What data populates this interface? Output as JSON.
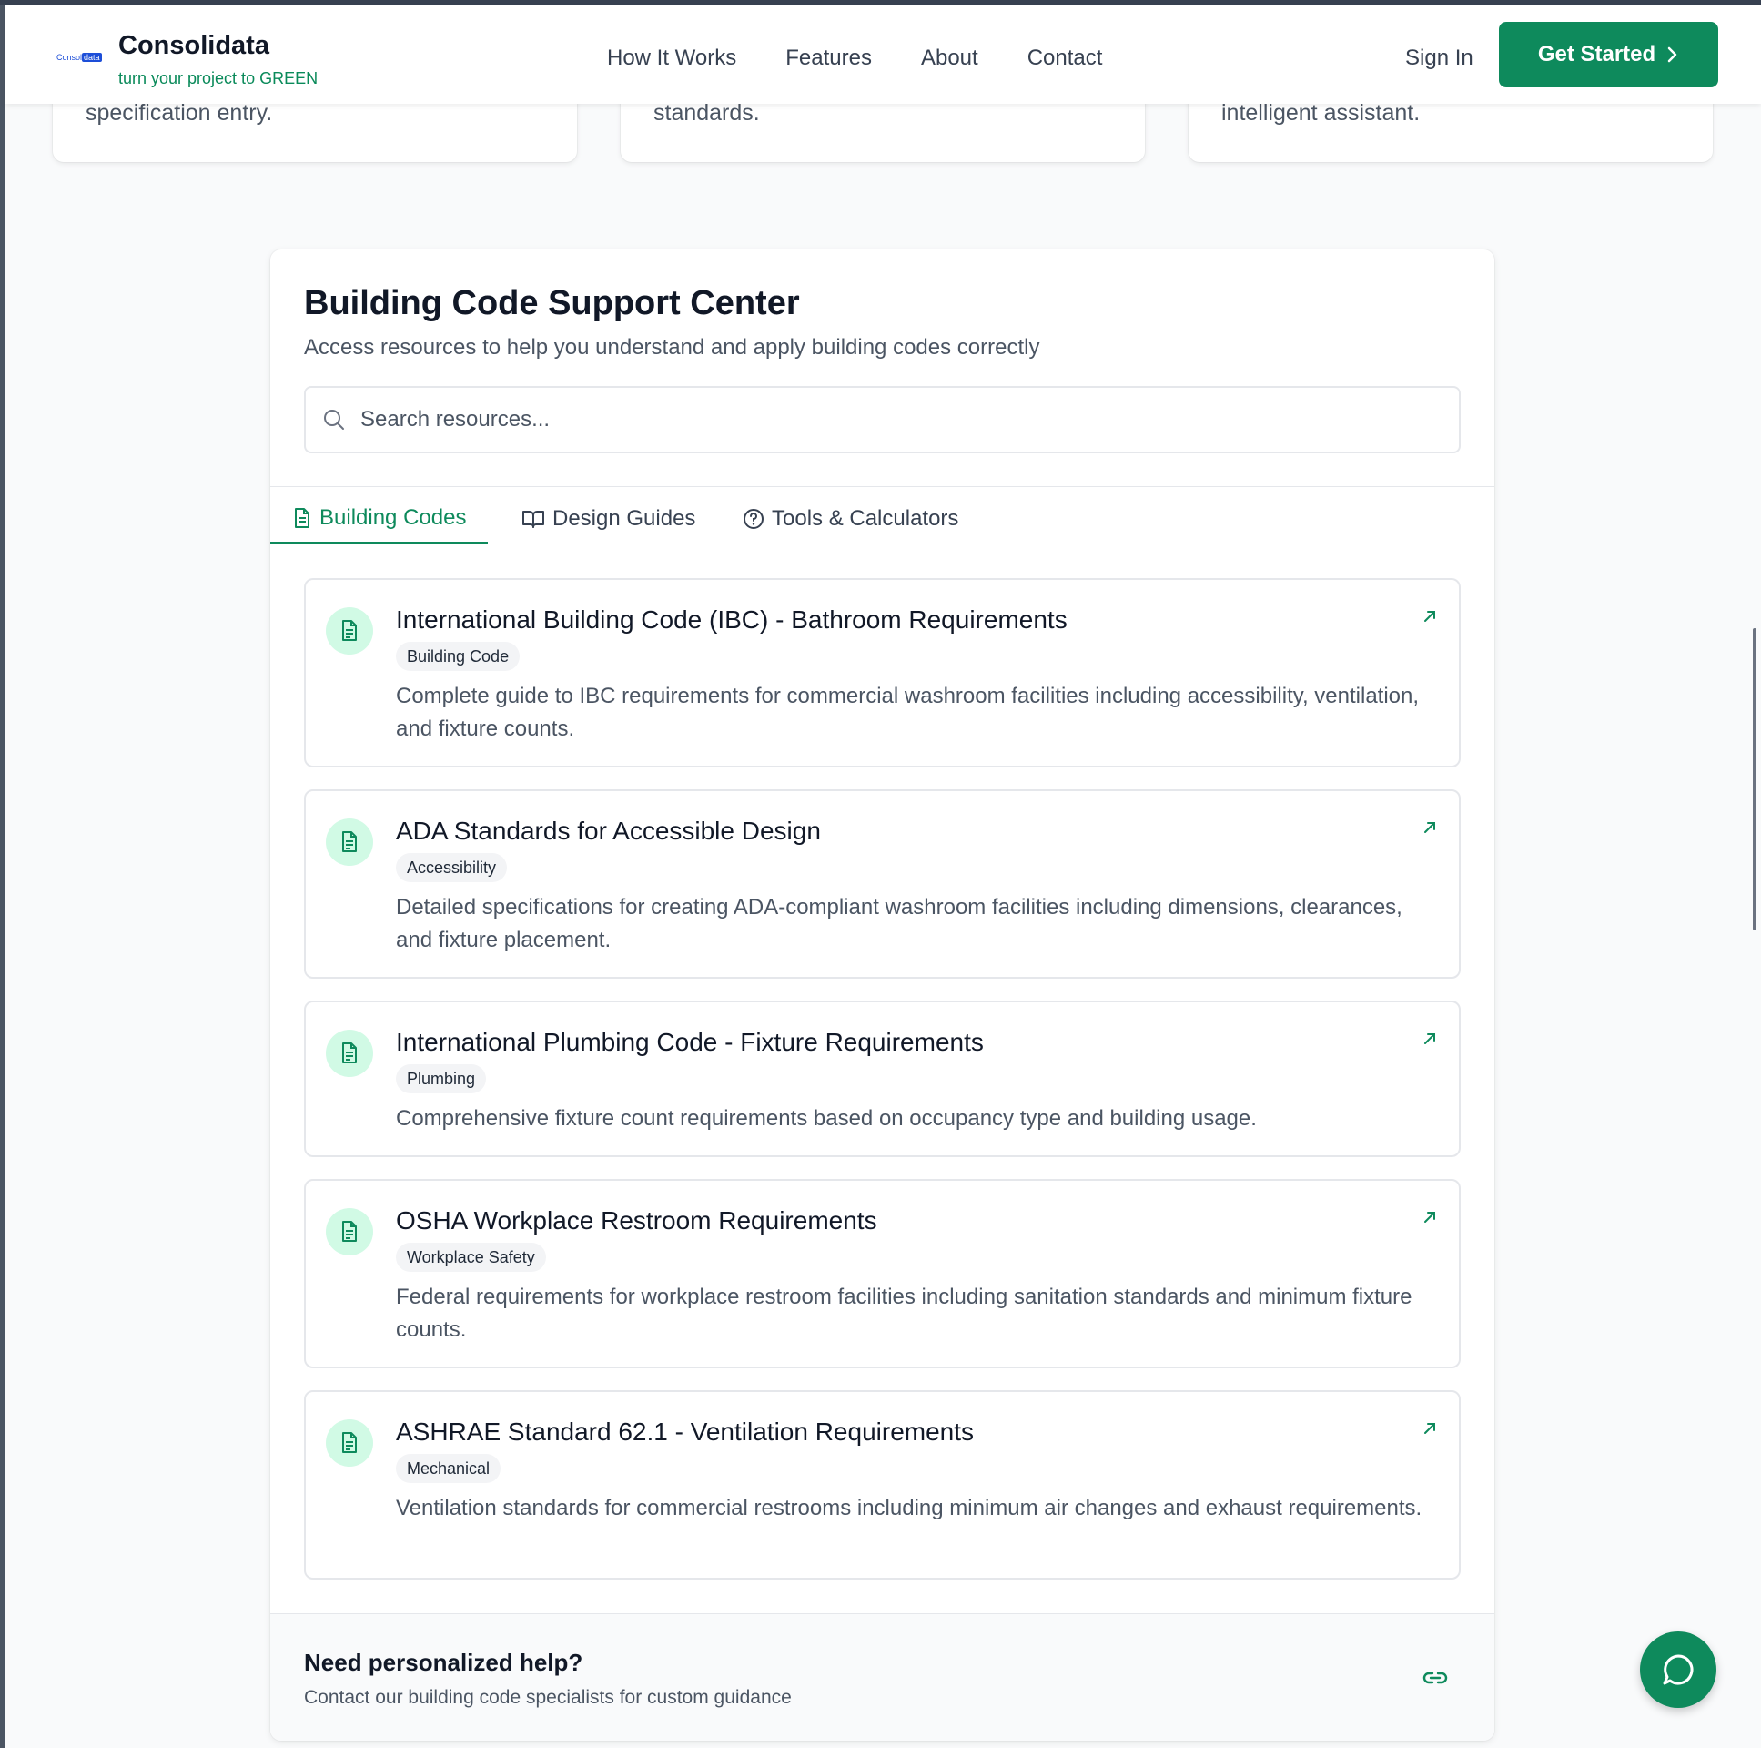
{
  "header": {
    "logo_text_a": "Consol",
    "logo_text_b": "data",
    "brand_name": "Consolidata",
    "tagline": "turn your project to GREEN",
    "nav": [
      "How It Works",
      "Features",
      "About",
      "Contact"
    ],
    "sign_in": "Sign In",
    "get_started": "Get Started"
  },
  "top_cards": [
    {
      "text": "specification entry."
    },
    {
      "text": "standards."
    },
    {
      "text": "intelligent assistant."
    }
  ],
  "panel": {
    "title": "Building Code Support Center",
    "subtitle": "Access resources to help you understand and apply building codes correctly",
    "search_placeholder": "Search resources...",
    "tabs": [
      {
        "label": "Building Codes",
        "icon": "document-icon",
        "active": true
      },
      {
        "label": "Design Guides",
        "icon": "book-icon",
        "active": false
      },
      {
        "label": "Tools & Calculators",
        "icon": "help-circle-icon",
        "active": false
      }
    ],
    "resources": [
      {
        "title": "International Building Code (IBC) - Bathroom Requirements",
        "badge": "Building Code",
        "description": "Complete guide to IBC requirements for commercial washroom facilities including accessibility, ventilation, and fixture counts."
      },
      {
        "title": "ADA Standards for Accessible Design",
        "badge": "Accessibility",
        "description": "Detailed specifications for creating ADA-compliant washroom facilities including dimensions, clearances, and fixture placement."
      },
      {
        "title": "International Plumbing Code - Fixture Requirements",
        "badge": "Plumbing",
        "description": "Comprehensive fixture count requirements based on occupancy type and building usage."
      },
      {
        "title": "OSHA Workplace Restroom Requirements",
        "badge": "Workplace Safety",
        "description": "Federal requirements for workplace restroom facilities including sanitation standards and minimum fixture counts."
      },
      {
        "title": "ASHRAE Standard 62.1 - Ventilation Requirements",
        "badge": "Mechanical",
        "description": "Ventilation standards for commercial restrooms including minimum air changes and exhaust requirements."
      }
    ],
    "help": {
      "title": "Need personalized help?",
      "subtitle": "Contact our building code specialists for custom guidance"
    }
  },
  "colors": {
    "accent": "#0e8a5c",
    "accent_light": "#d1fae5",
    "text": "#111827",
    "muted": "#4b5563"
  }
}
